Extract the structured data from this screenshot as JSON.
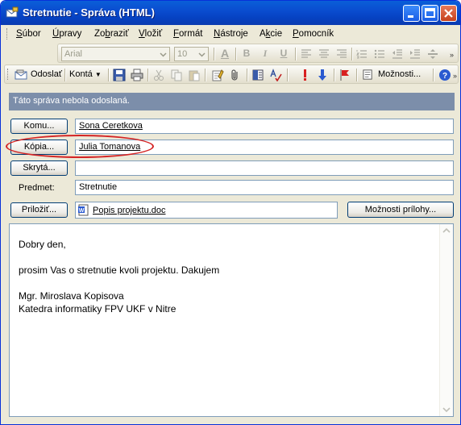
{
  "window": {
    "title": "Stretnutie - Správa (HTML)",
    "accent": "#0a4dd0"
  },
  "menu": {
    "items": [
      {
        "label": "Súbor",
        "underline": "S"
      },
      {
        "label": "Úpravy",
        "underline": "Ú"
      },
      {
        "label": "Zobraziť",
        "underline": "b"
      },
      {
        "label": "Vložiť",
        "underline": "V"
      },
      {
        "label": "Formát",
        "underline": "F"
      },
      {
        "label": "Nástroje",
        "underline": "N"
      },
      {
        "label": "Akcie",
        "underline": "k"
      },
      {
        "label": "Pomocník",
        "underline": "P"
      }
    ]
  },
  "format_toolbar": {
    "font_name": "Arial",
    "font_size": "10",
    "icons": [
      "font-color-icon",
      "bold-icon",
      "italic-icon",
      "underline-icon",
      "align-left-icon",
      "align-center-icon",
      "align-right-icon",
      "bullets-icon",
      "numbering-icon",
      "decrease-indent-icon",
      "increase-indent-icon",
      "horizontal-line-icon"
    ],
    "bold": "B",
    "italic": "I",
    "underline": "U",
    "font_color": "A"
  },
  "main_toolbar": {
    "send_label": "Odoslať",
    "accounts_label": "Kontá",
    "options_label": "Možnosti...",
    "icons": [
      "save-icon",
      "print-icon",
      "cut-icon",
      "copy-icon",
      "paste-icon",
      "check-names-icon",
      "attach-icon",
      "address-book-icon",
      "spelling-icon",
      "importance-high-icon",
      "importance-low-icon",
      "flag-icon",
      "options-icon",
      "help-icon"
    ]
  },
  "info_bar": {
    "text": "Táto správa nebola odoslaná."
  },
  "fields": {
    "to_button": "Komu...",
    "to_value": "Sona Ceretkova",
    "cc_button": "Kópia...",
    "cc_value": "Julia Tomanova",
    "bcc_button": "Skrytá...",
    "bcc_value": "",
    "subject_label": "Predmet:",
    "subject_value": "Stretnutie",
    "attach_button": "Priložiť...",
    "attachment_name": "Popis projektu.doc",
    "attach_options_button": "Možnosti prílohy..."
  },
  "body": {
    "lines": [
      "Dobry den,",
      "",
      "prosim Vas o stretnutie kvoli projektu. Dakujem",
      "",
      "Mgr. Miroslava Kopisova",
      "Katedra informatiky FPV UKF v Nitre"
    ]
  },
  "colors": {
    "highlight": "#d42424",
    "infobar": "#7c8eaa",
    "window_face": "#ece9d8"
  }
}
